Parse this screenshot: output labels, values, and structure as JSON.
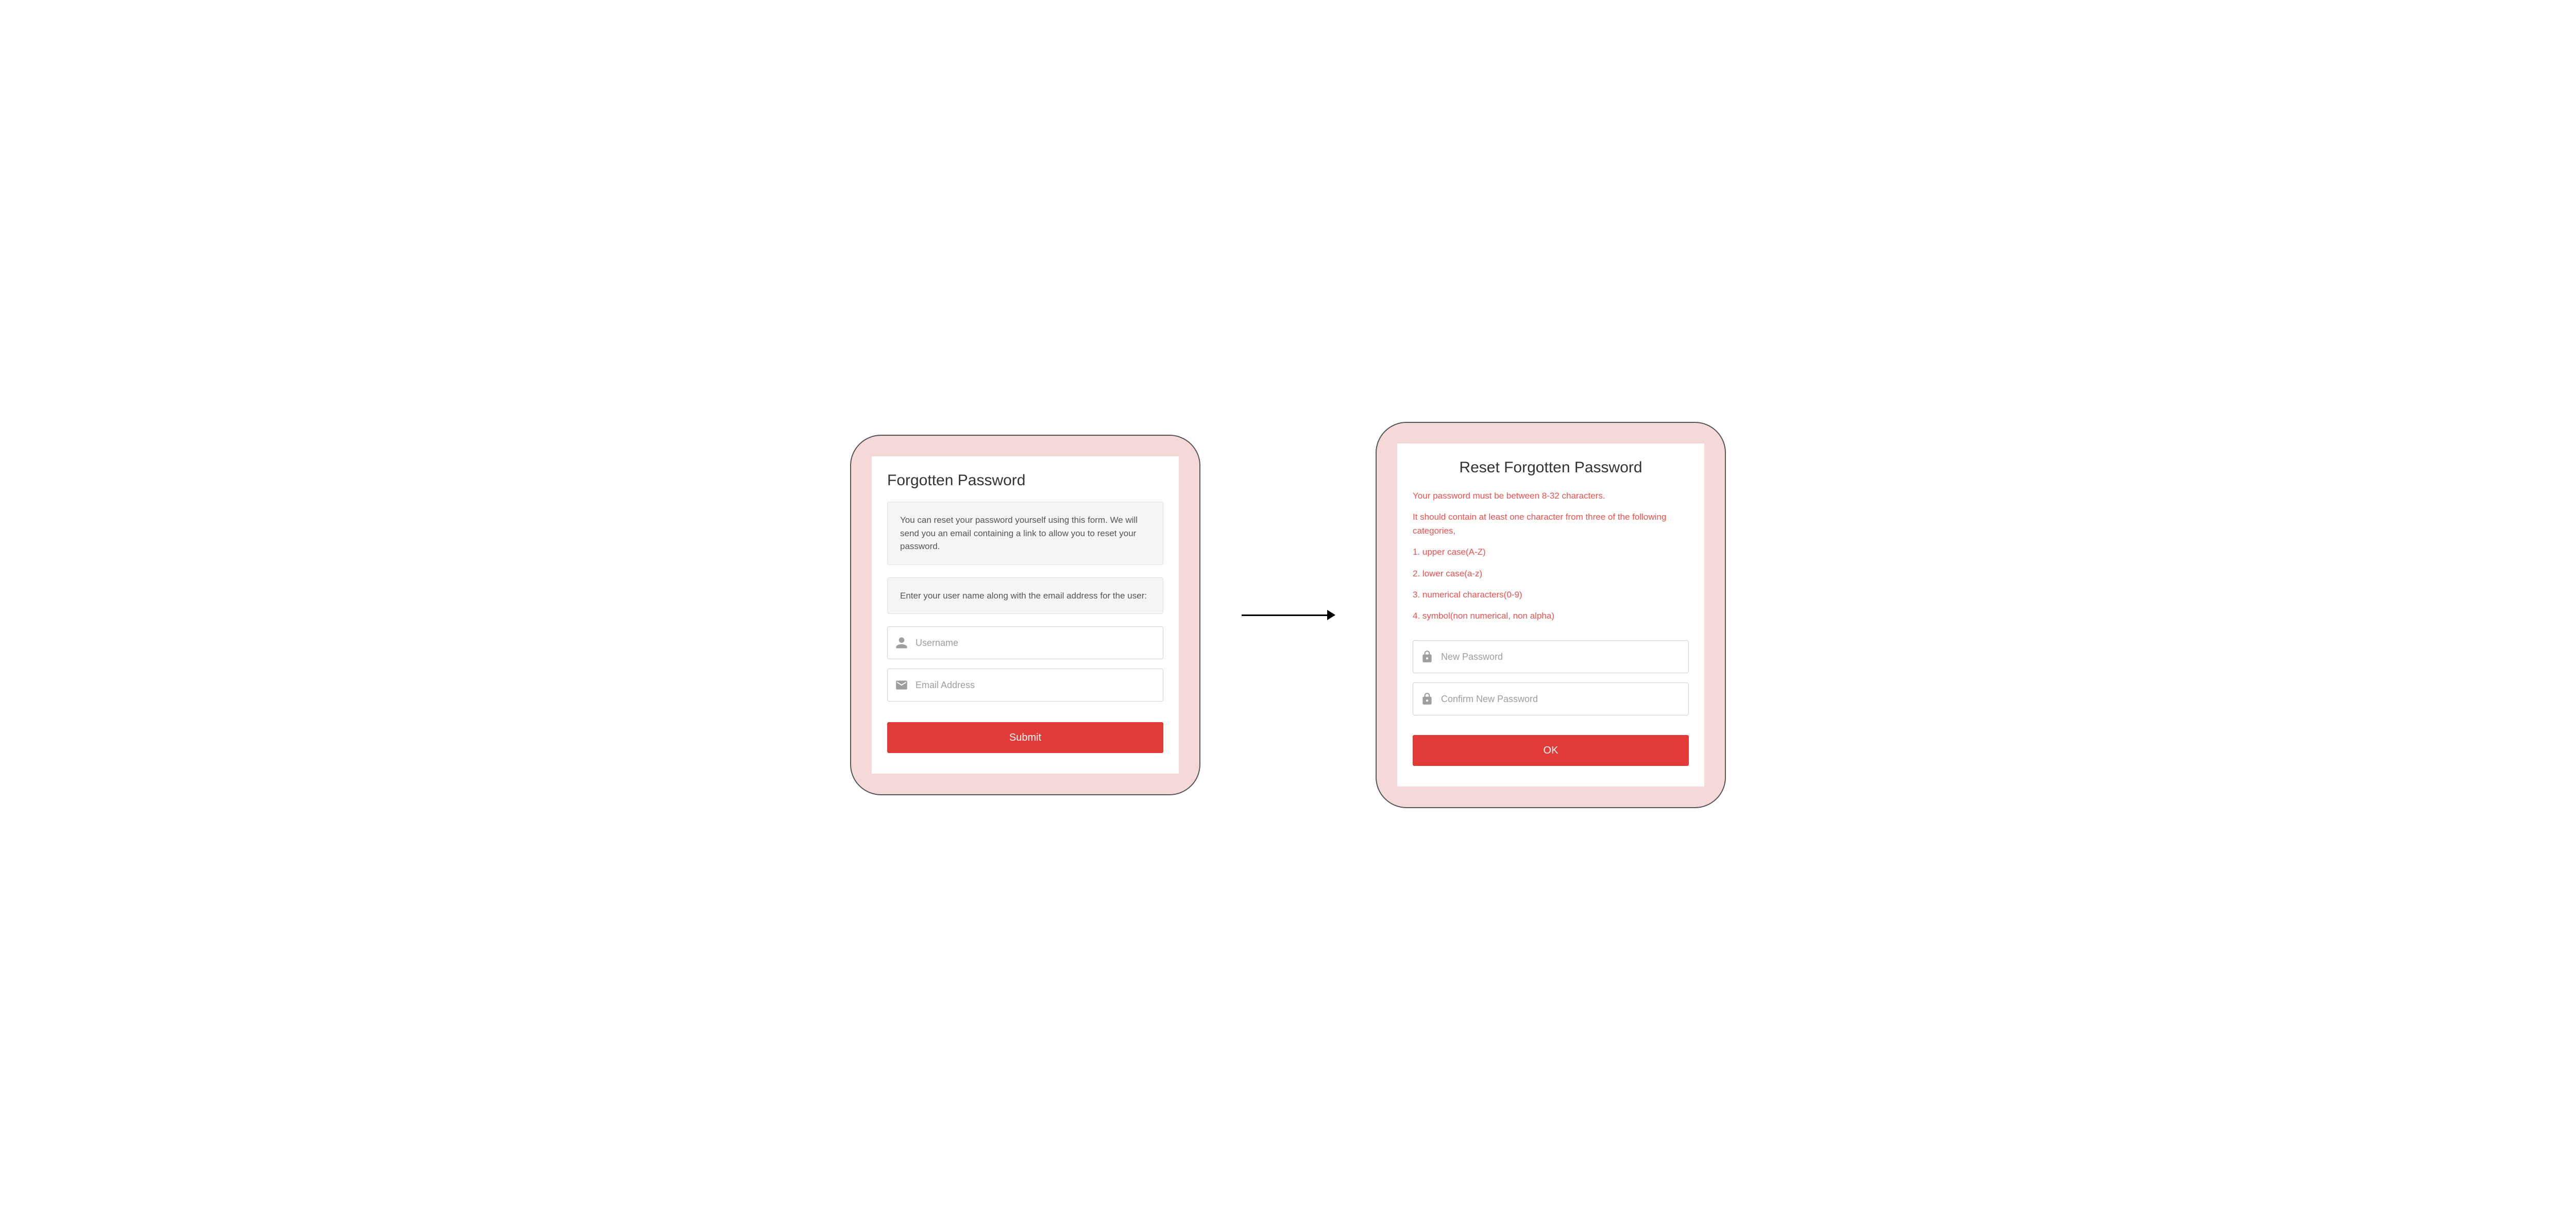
{
  "left": {
    "title": "Forgotten Password",
    "info1": "You can reset your password yourself using this form. We will send you an email containing a link to allow you to reset your password.",
    "info2": "Enter your user name along with the email address for the user:",
    "username_placeholder": "Username",
    "email_placeholder": "Email Address",
    "submit_label": "Submit"
  },
  "right": {
    "title": "Reset Forgotten Password",
    "rule_intro": "Your password must be between 8-32 characters.",
    "rule_sub": "It should contain at least one character from three of the following categories,",
    "rule1": "1. upper case(A-Z)",
    "rule2": "2. lower case(a-z)",
    "rule3": "3. numerical characters(0-9)",
    "rule4": "4. symbol(non numerical, non alpha)",
    "new_pw_placeholder": "New Password",
    "confirm_pw_placeholder": "Confirm New Password",
    "ok_label": "OK"
  }
}
